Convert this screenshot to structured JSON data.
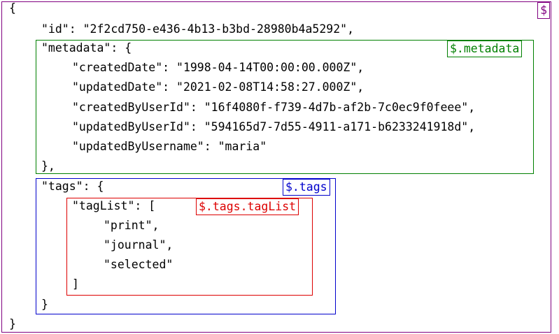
{
  "colors": {
    "root": "#800080",
    "metadata": "#008000",
    "tags": "#0000cc",
    "tagList": "#dd0000"
  },
  "labels": {
    "root": "$",
    "metadata": "$.metadata",
    "tags": "$.tags",
    "tagList": "$.tags.tagList"
  },
  "lines": [
    "{",
    "\"id\": \"2f2cd750-e436-4b13-b3bd-28980b4a5292\",",
    "\"metadata\": {",
    "\"createdDate\": \"1998-04-14T00:00:00.000Z\",",
    "\"updatedDate\": \"2021-02-08T14:58:27.000Z\",",
    "\"createdByUserId\": \"16f4080f-f739-4d7b-af2b-7c0ec9f0feee\",",
    "\"updatedByUserId\": \"594165d7-7d55-4911-a171-b6233241918d\",",
    "\"updatedByUsername\": \"maria\"",
    "},",
    "\"tags\": {",
    "\"tagList\": [",
    "\"print\",",
    "\"journal\",",
    "\"selected\"",
    "]",
    "}",
    "}"
  ]
}
